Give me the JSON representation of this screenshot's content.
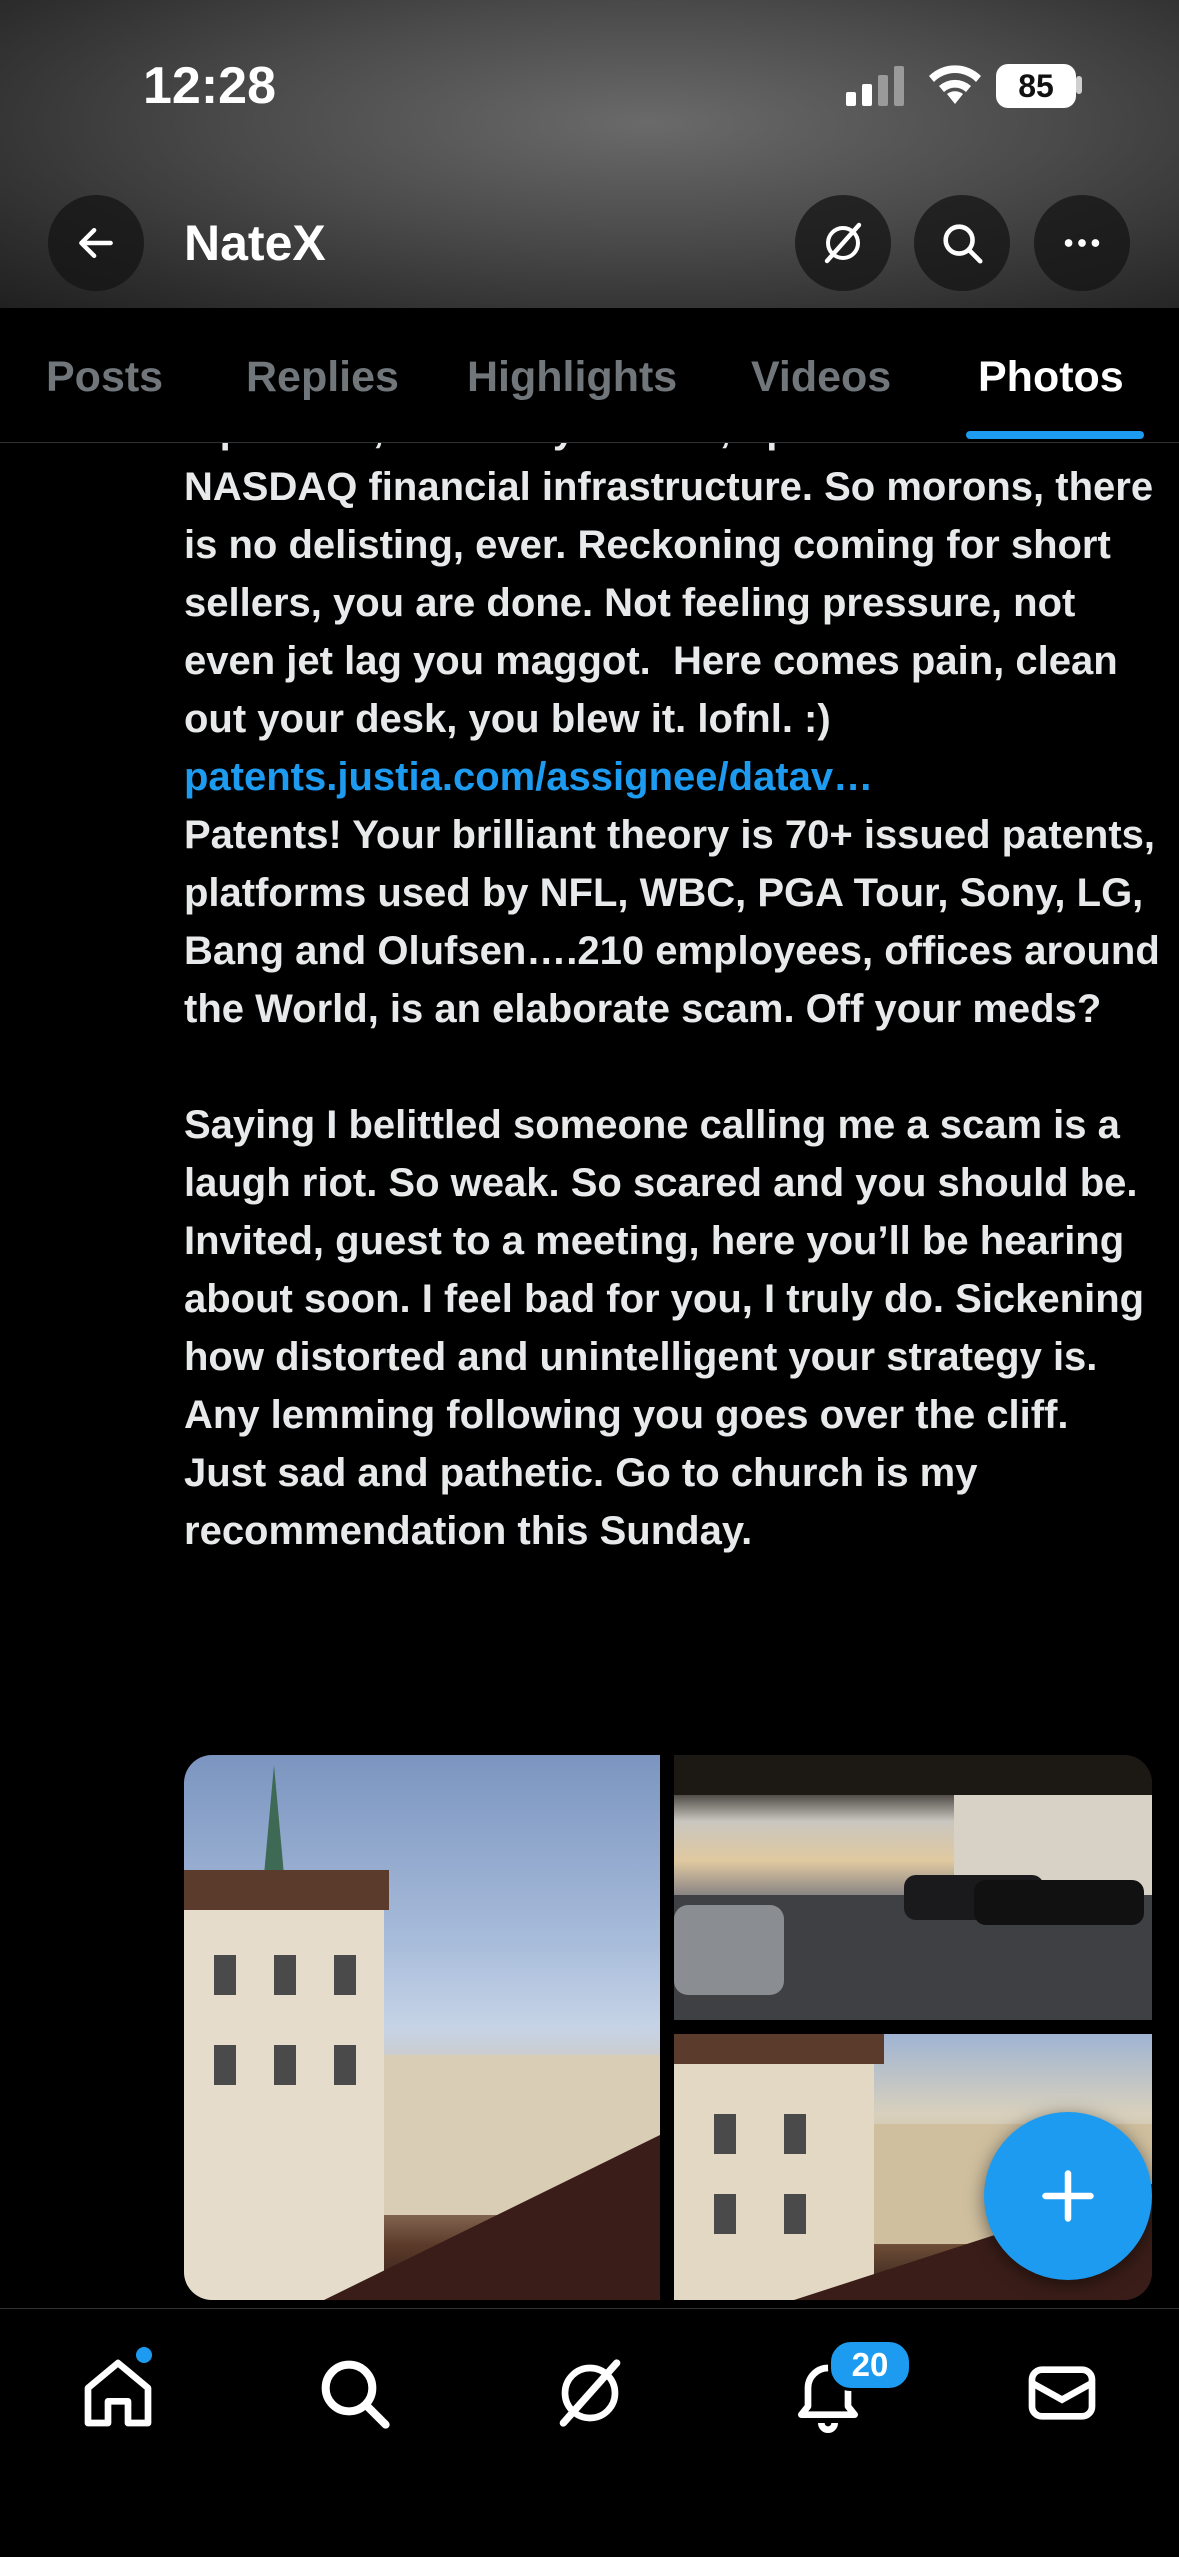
{
  "status_bar": {
    "time": "12:28",
    "battery": "85"
  },
  "header": {
    "title": "NateX"
  },
  "tabs": [
    {
      "label": "Posts"
    },
    {
      "label": "Replies"
    },
    {
      "label": "Highlights"
    },
    {
      "label": "Videos"
    },
    {
      "label": "Photos",
      "active": true
    }
  ],
  "post": {
    "cut_line": "aquisition, not that you read, operates on",
    "para1": "NASDAQ financial infrastructure. So morons, there is no delisting, ever. Reckoning coming for short sellers, you are done. Not feeling pressure, not even jet lag you maggot.  Here comes pain, clean out your desk, you blew it. lofnl. :)",
    "link": "patents.justia.com/assignee/datav…",
    "para2": "Patents! Your brilliant theory is 70+ issued patents, platforms used by NFL, WBC, PGA Tour, Sony, LG, Bang and Olufsen….210 employees, offices around the World, is an elaborate scam. Off your meds?",
    "para3": "Saying I belittled someone calling me a scam is a laugh riot. So weak. So scared and you should be.  Invited, guest to a meeting, here you’ll be hearing about soon. I feel bad for you, I truly do. Sickening how distorted and unintelligent your strategy is.  Any lemming following you goes over the cliff.  Just sad and pathetic. Go to church is my recommendation this Sunday."
  },
  "notifications_count": "20",
  "colors": {
    "accent": "#1d9bf0",
    "background": "#000000",
    "text": "#e7e9ea",
    "muted": "#71767b"
  }
}
